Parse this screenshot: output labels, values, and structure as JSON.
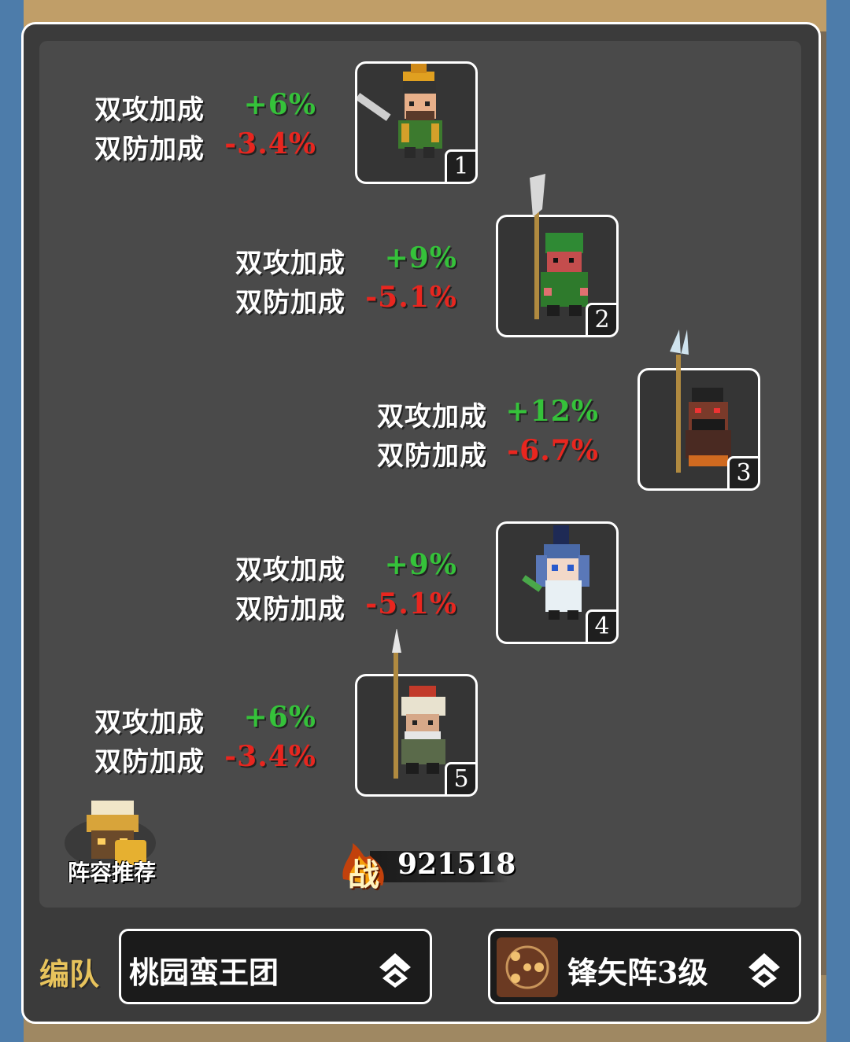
{
  "lineup": [
    {
      "slot": "1",
      "atk_label": "双攻加成",
      "atk_value": "+6%",
      "def_label": "双防加成",
      "def_value": "-3.4%"
    },
    {
      "slot": "2",
      "atk_label": "双攻加成",
      "atk_value": "+9%",
      "def_label": "双防加成",
      "def_value": "-5.1%"
    },
    {
      "slot": "3",
      "atk_label": "双攻加成",
      "atk_value": "+12%",
      "def_label": "双防加成",
      "def_value": "-6.7%"
    },
    {
      "slot": "4",
      "atk_label": "双攻加成",
      "atk_value": "+9%",
      "def_label": "双防加成",
      "def_value": "-5.1%"
    },
    {
      "slot": "5",
      "atk_label": "双攻加成",
      "atk_value": "+6%",
      "def_label": "双防加成",
      "def_value": "-3.4%"
    }
  ],
  "recommend": {
    "label": "阵容推荐"
  },
  "power": {
    "glyph": "战",
    "value": "921518"
  },
  "team": {
    "label": "编队",
    "name": "桃园蛮王团"
  },
  "formation": {
    "name": "锋矢阵3级"
  },
  "colors": {
    "atk": "#35c23a",
    "def": "#e8261f",
    "label_gold": "#e7c35c"
  }
}
